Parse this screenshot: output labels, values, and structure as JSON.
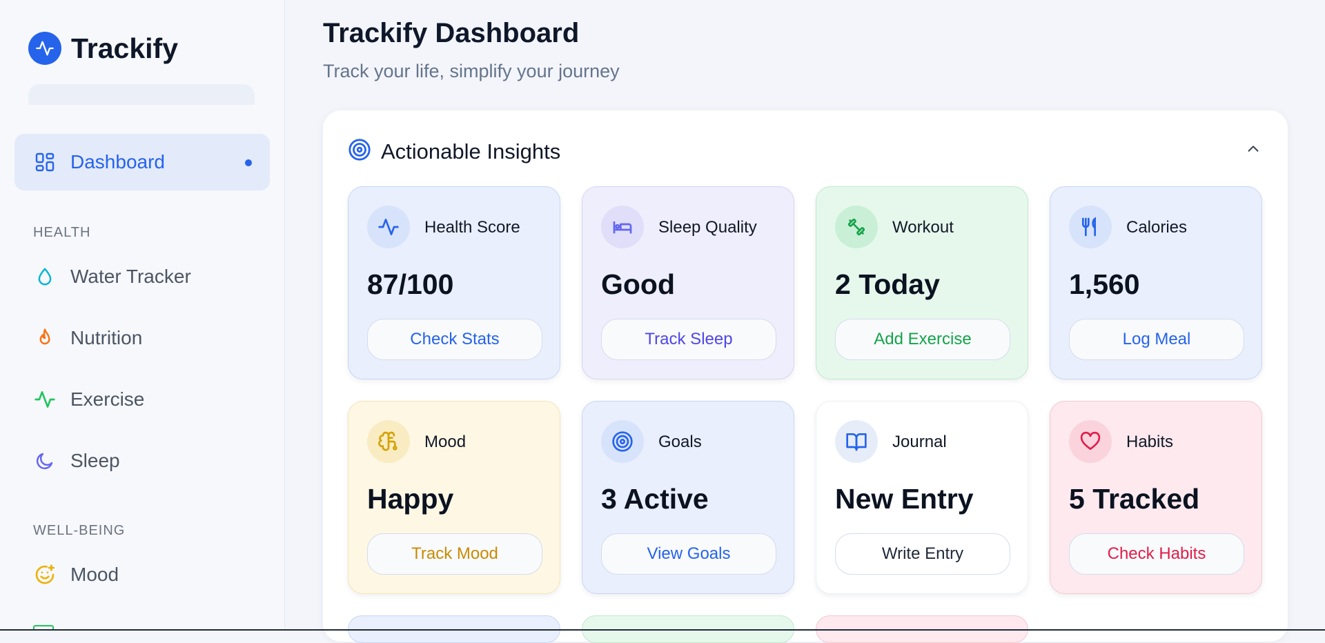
{
  "app": {
    "name": "Trackify"
  },
  "sidebar": {
    "active_item": {
      "label": "Dashboard"
    },
    "sections": [
      {
        "title": "HEALTH",
        "items": [
          {
            "label": "Water Tracker",
            "icon": "droplet-icon",
            "color": "#06b6d4"
          },
          {
            "label": "Nutrition",
            "icon": "flame-icon",
            "color": "#f97316"
          },
          {
            "label": "Exercise",
            "icon": "activity-icon",
            "color": "#22c55e"
          },
          {
            "label": "Sleep",
            "icon": "moon-icon",
            "color": "#6366f1"
          }
        ]
      },
      {
        "title": "WELL-BEING",
        "items": [
          {
            "label": "Mood",
            "icon": "smile-plus-icon",
            "color": "#eab308"
          }
        ]
      }
    ]
  },
  "header": {
    "title": "Trackify Dashboard",
    "subtitle": "Track your life, simplify your journey"
  },
  "insights": {
    "title": "Actionable Insights",
    "cards": [
      {
        "label": "Health Score",
        "value": "87/100",
        "button": "Check Stats",
        "icon": "activity-icon",
        "accent": "#2563eb"
      },
      {
        "label": "Sleep Quality",
        "value": "Good",
        "button": "Track Sleep",
        "icon": "bed-icon",
        "accent": "#6366f1"
      },
      {
        "label": "Workout",
        "value": "2 Today",
        "button": "Add Exercise",
        "icon": "dumbbell-icon",
        "accent": "#22c55e"
      },
      {
        "label": "Calories",
        "value": "1,560",
        "button": "Log Meal",
        "icon": "utensils-icon",
        "accent": "#2563eb"
      },
      {
        "label": "Mood",
        "value": "Happy",
        "button": "Track Mood",
        "icon": "brain-icon",
        "accent": "#eab308"
      },
      {
        "label": "Goals",
        "value": "3 Active",
        "button": "View Goals",
        "icon": "target-icon",
        "accent": "#2563eb"
      },
      {
        "label": "Journal",
        "value": "New Entry",
        "button": "Write Entry",
        "icon": "book-open-icon",
        "accent": "#1f2937"
      },
      {
        "label": "Habits",
        "value": "5 Tracked",
        "button": "Check Habits",
        "icon": "heart-icon",
        "accent": "#e11d48"
      }
    ]
  }
}
